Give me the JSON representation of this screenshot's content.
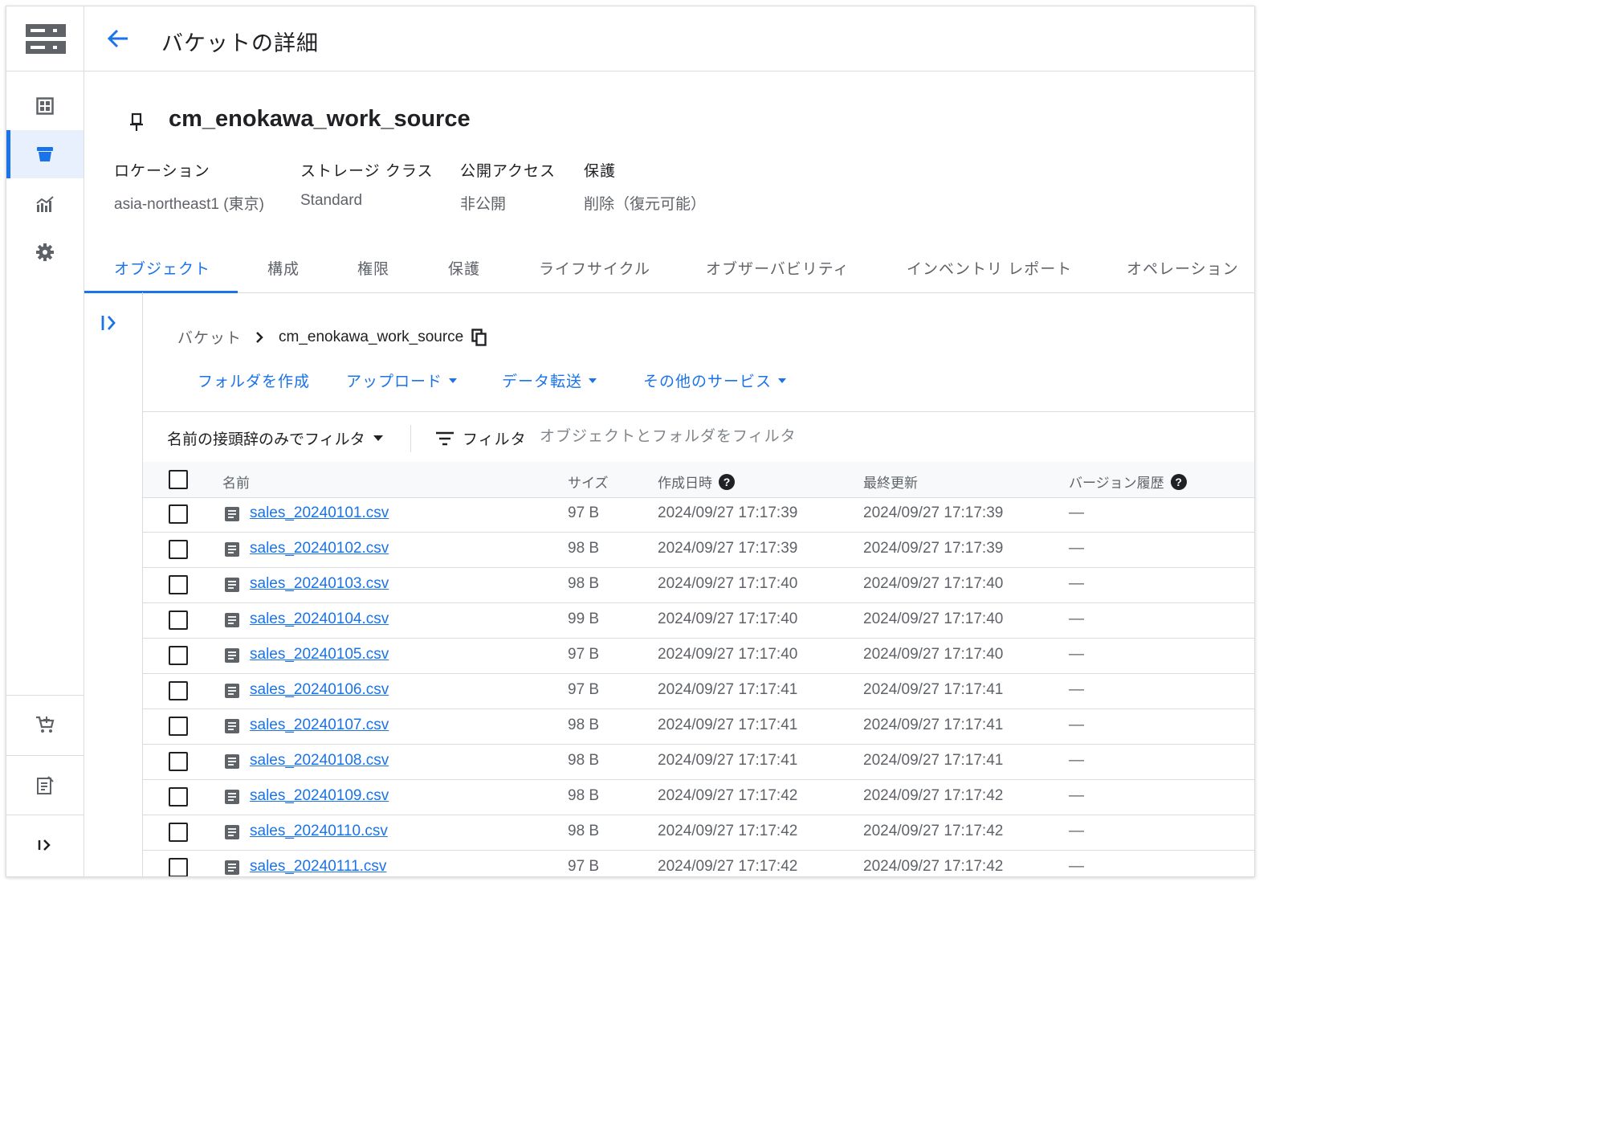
{
  "header": {
    "title": "バケットの詳細"
  },
  "bucket": {
    "name": "cm_enokawa_work_source",
    "meta": [
      {
        "label": "ロケーション",
        "value": "asia-northeast1 (東京)"
      },
      {
        "label": "ストレージ クラス",
        "value": "Standard"
      },
      {
        "label": "公開アクセス",
        "value": "非公開"
      },
      {
        "label": "保護",
        "value": "削除（復元可能）"
      }
    ]
  },
  "tabs": [
    "オブジェクト",
    "構成",
    "権限",
    "保護",
    "ライフサイクル",
    "オブザーバビリティ",
    "インベントリ レポート",
    "オペレーション"
  ],
  "breadcrumb": {
    "root": "バケット",
    "current": "cm_enokawa_work_source"
  },
  "actions": [
    "フォルダを作成",
    "アップロード",
    "データ転送",
    "その他のサービス"
  ],
  "filter": {
    "prefix_label": "名前の接頭辞のみでフィルタ",
    "label": "フィルタ",
    "placeholder": "オブジェクトとフォルダをフィルタ"
  },
  "table": {
    "columns": [
      "名前",
      "サイズ",
      "作成日時",
      "最終更新",
      "バージョン履歴"
    ],
    "rows": [
      {
        "name": "sales_20240101.csv",
        "size": "97 B",
        "created": "2024/09/27 17:17:39",
        "updated": "2024/09/27 17:17:39",
        "versions": "—"
      },
      {
        "name": "sales_20240102.csv",
        "size": "98 B",
        "created": "2024/09/27 17:17:39",
        "updated": "2024/09/27 17:17:39",
        "versions": "—"
      },
      {
        "name": "sales_20240103.csv",
        "size": "98 B",
        "created": "2024/09/27 17:17:40",
        "updated": "2024/09/27 17:17:40",
        "versions": "—"
      },
      {
        "name": "sales_20240104.csv",
        "size": "99 B",
        "created": "2024/09/27 17:17:40",
        "updated": "2024/09/27 17:17:40",
        "versions": "—"
      },
      {
        "name": "sales_20240105.csv",
        "size": "97 B",
        "created": "2024/09/27 17:17:40",
        "updated": "2024/09/27 17:17:40",
        "versions": "—"
      },
      {
        "name": "sales_20240106.csv",
        "size": "97 B",
        "created": "2024/09/27 17:17:41",
        "updated": "2024/09/27 17:17:41",
        "versions": "—"
      },
      {
        "name": "sales_20240107.csv",
        "size": "98 B",
        "created": "2024/09/27 17:17:41",
        "updated": "2024/09/27 17:17:41",
        "versions": "—"
      },
      {
        "name": "sales_20240108.csv",
        "size": "98 B",
        "created": "2024/09/27 17:17:41",
        "updated": "2024/09/27 17:17:41",
        "versions": "—"
      },
      {
        "name": "sales_20240109.csv",
        "size": "98 B",
        "created": "2024/09/27 17:17:42",
        "updated": "2024/09/27 17:17:42",
        "versions": "—"
      },
      {
        "name": "sales_20240110.csv",
        "size": "98 B",
        "created": "2024/09/27 17:17:42",
        "updated": "2024/09/27 17:17:42",
        "versions": "—"
      },
      {
        "name": "sales_20240111.csv",
        "size": "97 B",
        "created": "2024/09/27 17:17:42",
        "updated": "2024/09/27 17:17:42",
        "versions": "—"
      }
    ]
  },
  "colors": {
    "accent": "#1a73e8",
    "active_bg": "#e8f0fe",
    "border": "#dadce0"
  }
}
